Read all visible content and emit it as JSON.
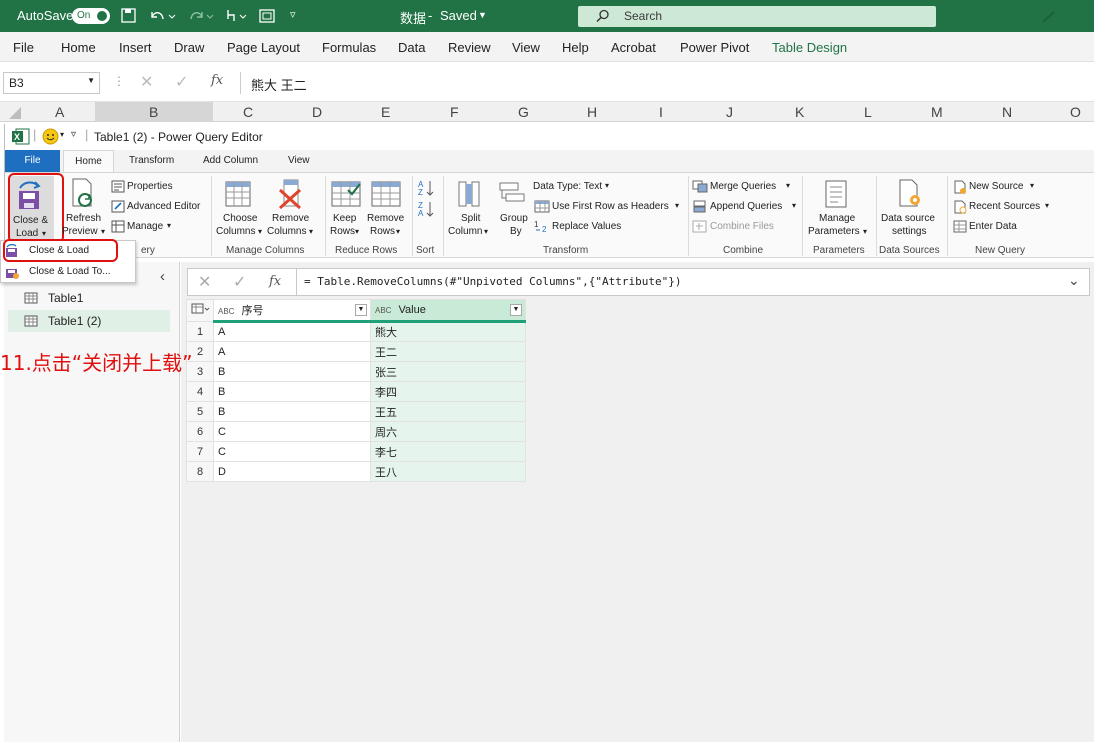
{
  "excel": {
    "autosave_label": "AutoSave",
    "autosave_state": "On",
    "file_name": "数据",
    "save_state": "Saved",
    "search_placeholder": "Search",
    "menu": [
      "File",
      "Home",
      "Insert",
      "Draw",
      "Page Layout",
      "Formulas",
      "Data",
      "Review",
      "View",
      "Help",
      "Acrobat",
      "Power Pivot",
      "Table Design"
    ],
    "name_box": "B3",
    "fx_symbol": "fx",
    "formula_value": "熊大 王二",
    "columns": [
      "A",
      "B",
      "C",
      "D",
      "E",
      "F",
      "G",
      "H",
      "I",
      "J",
      "K",
      "L",
      "M",
      "N",
      "O"
    ],
    "accent_color": "#217346"
  },
  "pq": {
    "title": "Table1 (2) - Power Query Editor",
    "tabs": [
      "File",
      "Home",
      "Transform",
      "Add Column",
      "View"
    ],
    "ribbon": {
      "close_load": "Close &",
      "close_load2": "Load",
      "refresh": "Refresh",
      "refresh2": "Preview",
      "properties": "Properties",
      "advanced_editor": "Advanced Editor",
      "manage": "Manage",
      "choose_columns": "Choose",
      "choose_columns2": "Columns",
      "remove_columns": "Remove",
      "remove_columns2": "Columns",
      "manage_columns_group": "Manage Columns",
      "keep_rows": "Keep",
      "keep_rows2": "Rows",
      "remove_rows": "Remove",
      "remove_rows2": "Rows",
      "reduce_rows_group": "Reduce Rows",
      "sort_group": "Sort",
      "split_column": "Split",
      "split_column2": "Column",
      "group_by": "Group",
      "group_by2": "By",
      "data_type": "Data Type: Text",
      "use_first_row": "Use First Row as Headers",
      "replace_values": "Replace Values",
      "transform_group": "Transform",
      "merge_queries": "Merge Queries",
      "append_queries": "Append Queries",
      "combine_files": "Combine Files",
      "combine_group": "Combine",
      "manage_parameters": "Manage",
      "manage_parameters2": "Parameters",
      "parameters_group": "Parameters",
      "data_source_settings": "Data source",
      "data_source_settings2": "settings",
      "data_sources_group": "Data Sources",
      "new_source": "New Source",
      "recent_sources": "Recent Sources",
      "enter_data": "Enter Data",
      "new_query_group": "New Query",
      "query_group_partial": "ery"
    },
    "dropdown": [
      "Close & Load",
      "Close & Load To..."
    ],
    "queries": [
      "Table1",
      "Table1 (2)"
    ],
    "formula": "= Table.RemoveColumns(#\"Unpivoted Columns\",{\"Attribute\"})",
    "fx_symbol": "fx",
    "table": {
      "headers": [
        "序号",
        "Value"
      ],
      "type_badge": "ABC",
      "rows": [
        [
          "1",
          "A",
          "熊大"
        ],
        [
          "2",
          "A",
          "王二"
        ],
        [
          "3",
          "B",
          "张三"
        ],
        [
          "4",
          "B",
          "李四"
        ],
        [
          "5",
          "B",
          "王五"
        ],
        [
          "6",
          "C",
          "周六"
        ],
        [
          "7",
          "C",
          "李七"
        ],
        [
          "8",
          "D",
          "王八"
        ]
      ]
    }
  },
  "annotation": {
    "text": "11.点击“关闭并上载”",
    "color": "#e01010"
  }
}
